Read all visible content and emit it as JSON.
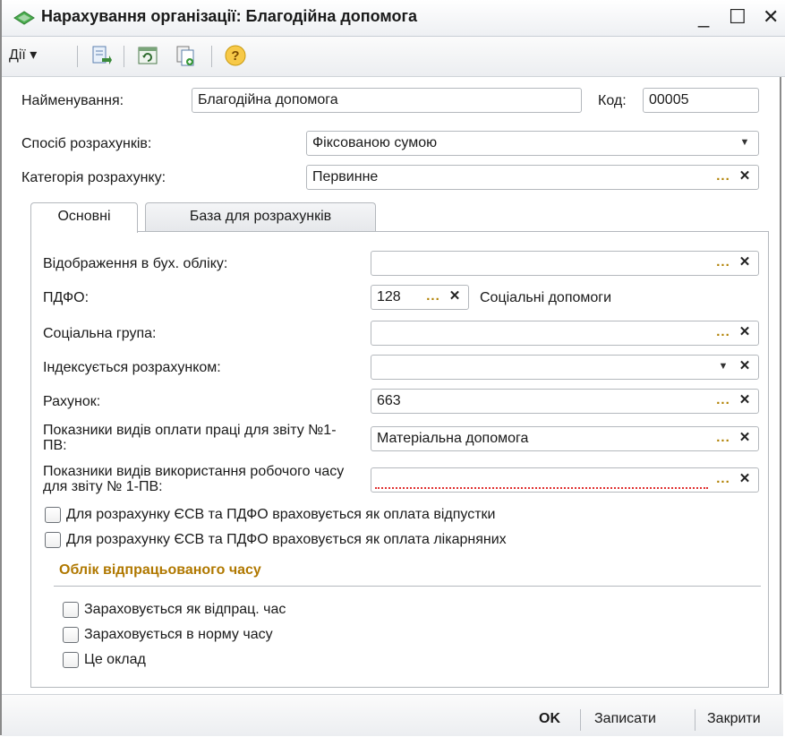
{
  "window": {
    "title": "Нарахування організації: Благодійна допомога",
    "minimize": "_",
    "maximize": "☐",
    "close": "✕"
  },
  "toolbar": {
    "actions_label": "Дії ▾",
    "icons": [
      "post-icon",
      "refresh-icon",
      "copy-doc-icon",
      "help-icon"
    ]
  },
  "form": {
    "name_label": "Найменування:",
    "name_value": "Благодійна допомога",
    "code_label": "Код:",
    "code_value": "00005",
    "calc_method_label": "Спосіб розрахунків:",
    "calc_method_value": "Фіксованою сумою",
    "calc_category_label": "Категорія розрахунку:",
    "calc_category_value": "Первинне"
  },
  "tabs": [
    {
      "label": "Основні",
      "active": true
    },
    {
      "label": "База для розрахунків",
      "active": false
    }
  ],
  "main": {
    "accounting_label": "Відображення в бух. обліку:",
    "accounting_value": "",
    "pdfo_label": "ПДФО:",
    "pdfo_code": "128",
    "pdfo_description": "Соціальні допомоги",
    "social_group_label": "Соціальна група:",
    "social_group_value": "",
    "indexed_label": "Індексується розрахунком:",
    "indexed_value": "",
    "account_label": "Рахунок:",
    "account_value": "663",
    "pay_types_label": "Показники видів оплати праці для звіту №1-ПВ:",
    "pay_types_value": "Матеріальна допомога",
    "time_use_label": "Показники видів використання робочого часу для звіту № 1-ПВ:",
    "time_use_value": "",
    "vacation_checkbox_label": "Для розрахунку ЄСВ та ПДФО враховується як оплата відпустки",
    "sick_checkbox_label": "Для розрахунку ЄСВ та ПДФО враховується як оплата лікарняних",
    "worktime_section_title": "Облік відпрацьованого часу",
    "worked_time_checkbox_label": "Зараховується як відпрац. час",
    "norm_time_checkbox_label": "Зараховується в норму часу",
    "salary_checkbox_label": "Це оклад"
  },
  "footer": {
    "ok_label": "OK",
    "save_label": "Записати",
    "close_label": "Закрити"
  },
  "colors": {
    "section_title": "#b07800",
    "dots_button": "#b08000",
    "invalid_underline": "#e03030"
  }
}
